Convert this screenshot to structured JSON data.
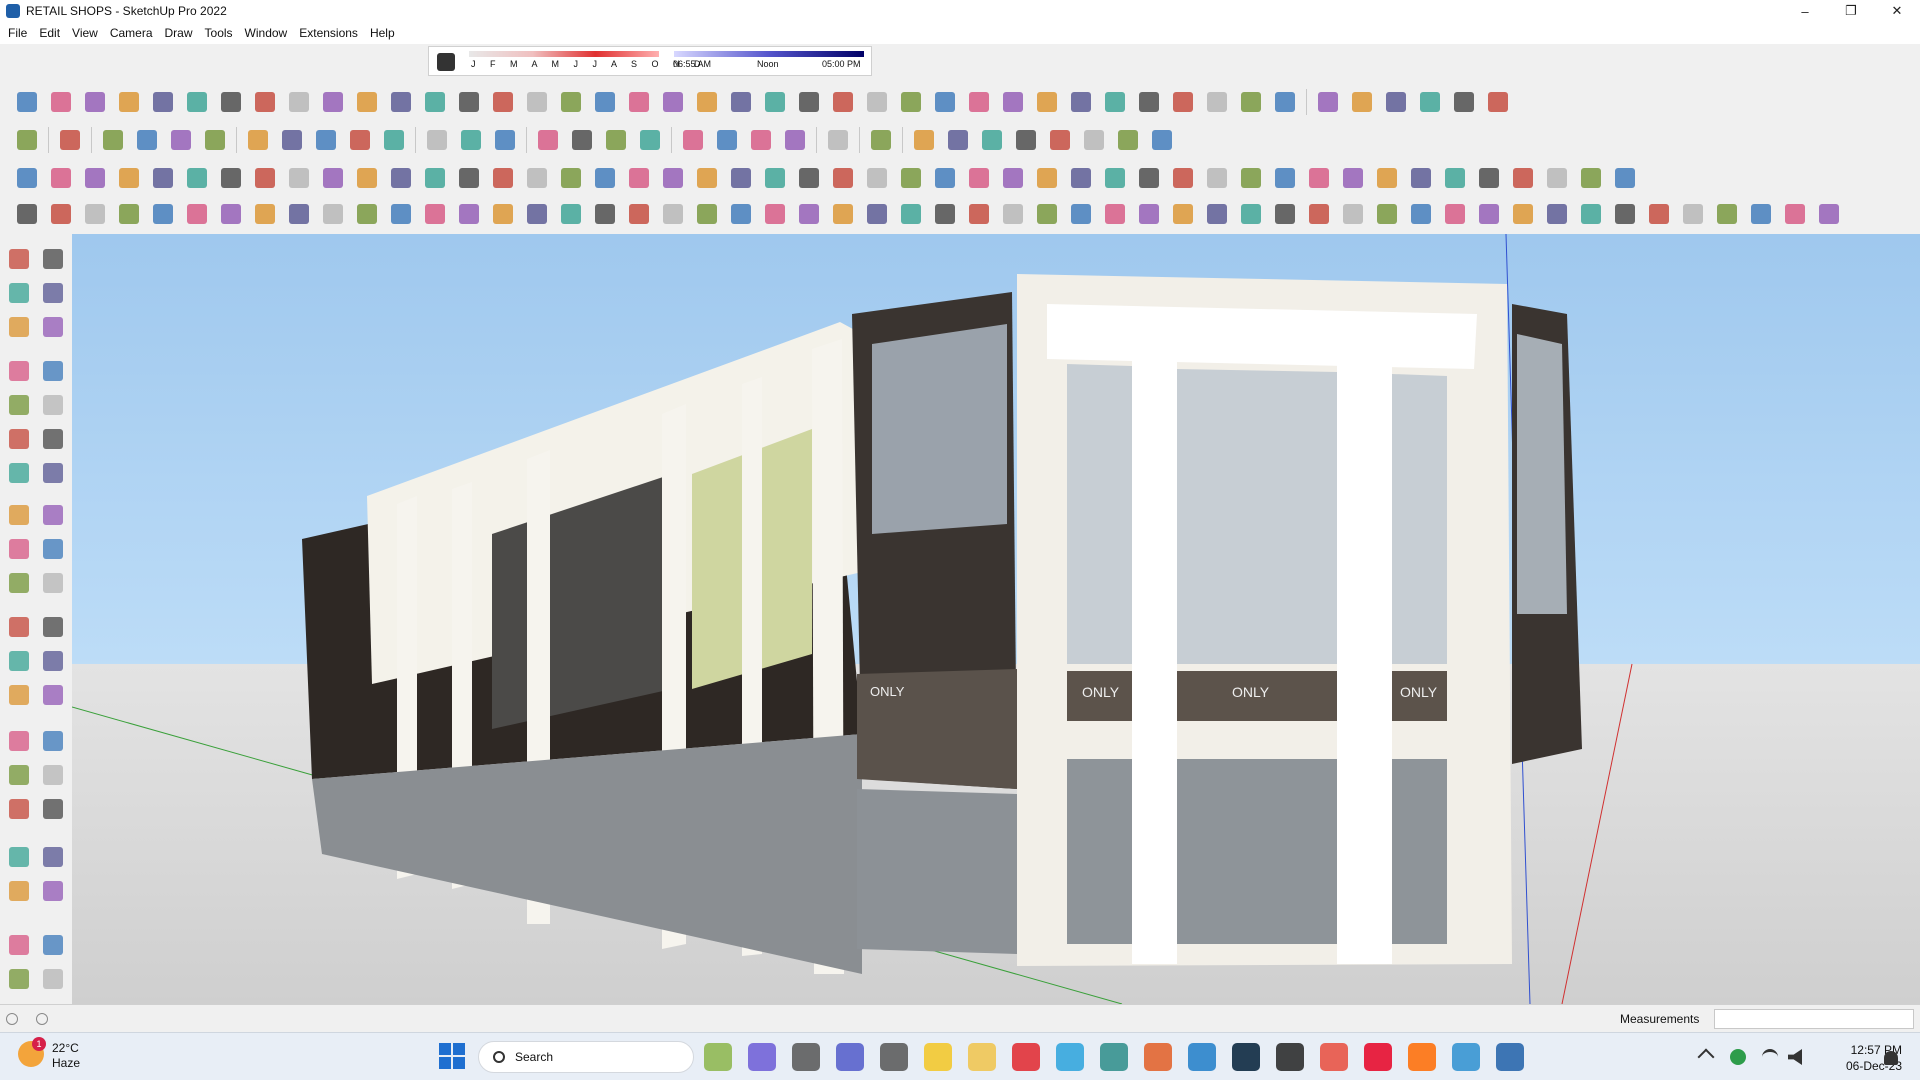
{
  "window": {
    "title": "RETAIL SHOPS - SketchUp Pro 2022",
    "minimize": "–",
    "maximize": "❐",
    "close": "✕"
  },
  "menu": [
    "File",
    "Edit",
    "View",
    "Camera",
    "Draw",
    "Tools",
    "Window",
    "Extensions",
    "Help"
  ],
  "shadows": {
    "months": "J F M A M J J A S O N D",
    "time_start": "06:55 AM",
    "time_mid": "Noon",
    "time_end": "05:00 PM"
  },
  "viewport": {
    "sign_text": "ONLY"
  },
  "status": {
    "measurements_label": "Measurements",
    "measurements_value": ""
  },
  "taskbar": {
    "weather_temp": "22°C",
    "weather_desc": "Haze",
    "weather_badge": "1",
    "search_placeholder": "Search",
    "clock_time": "12:57 PM",
    "clock_date": "06-Dec-23"
  },
  "colors": {
    "sky_top": "#9fc8ee",
    "ground": "#d8d8d8",
    "facade_light": "#f6f4ee",
    "facade_dark": "#3c3632",
    "glass": "#a9b3bc",
    "sign_band": "#5c534b"
  }
}
